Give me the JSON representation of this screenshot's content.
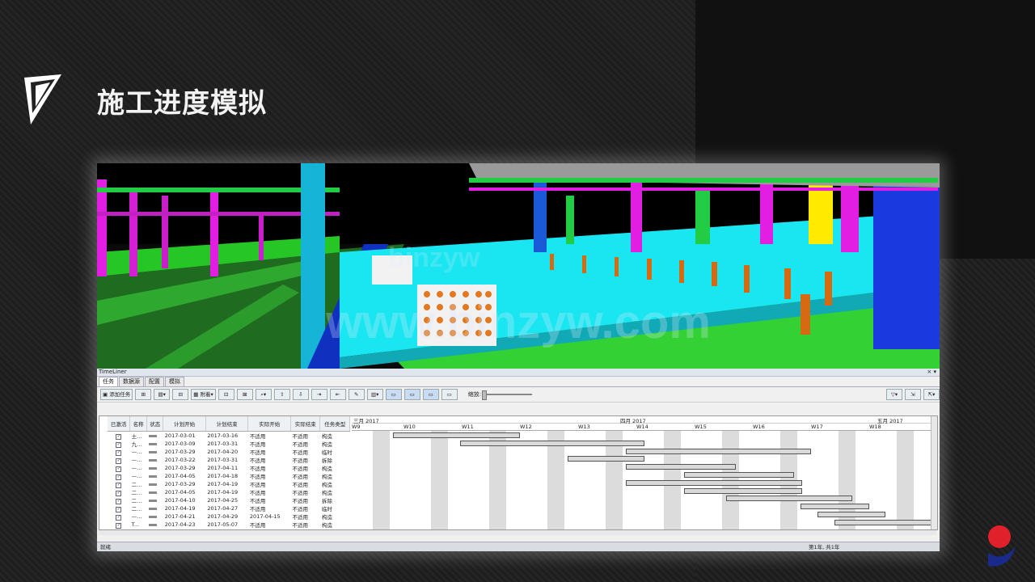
{
  "slide": {
    "title": "施工进度模拟"
  },
  "watermark": {
    "main": "www.binzyw.com",
    "small": "binzyw"
  },
  "timeliner": {
    "window_title": "TimeLiner",
    "tabs": [
      "任务",
      "数据源",
      "配置",
      "模拟"
    ],
    "toolbar": {
      "add_task": "添加任务",
      "attach": "附着",
      "zoom_label": "缩放:"
    },
    "columns": [
      "已激活",
      "名称",
      "状态",
      "计划开始",
      "计划结束",
      "实际开始",
      "实际结束",
      "任务类型"
    ],
    "rows": [
      {
        "name": "土...",
        "plan_start": "2017-03-01",
        "plan_end": "2017-03-16",
        "act_start": "不适用",
        "act_end": "不适用",
        "type": "构造"
      },
      {
        "name": "九...",
        "plan_start": "2017-03-09",
        "plan_end": "2017-03-31",
        "act_start": "不适用",
        "act_end": "不适用",
        "type": "构造"
      },
      {
        "name": "—...",
        "plan_start": "2017-03-29",
        "plan_end": "2017-04-20",
        "act_start": "不适用",
        "act_end": "不适用",
        "type": "临时"
      },
      {
        "name": "—...",
        "plan_start": "2017-03-22",
        "plan_end": "2017-03-31",
        "act_start": "不适用",
        "act_end": "不适用",
        "type": "拆除"
      },
      {
        "name": "—...",
        "plan_start": "2017-03-29",
        "plan_end": "2017-04-11",
        "act_start": "不适用",
        "act_end": "不适用",
        "type": "构造"
      },
      {
        "name": "—...",
        "plan_start": "2017-04-05",
        "plan_end": "2017-04-18",
        "act_start": "不适用",
        "act_end": "不适用",
        "type": "构造"
      },
      {
        "name": "二...",
        "plan_start": "2017-03-29",
        "plan_end": "2017-04-19",
        "act_start": "不适用",
        "act_end": "不适用",
        "type": "构造"
      },
      {
        "name": "二...",
        "plan_start": "2017-04-05",
        "plan_end": "2017-04-19",
        "act_start": "不适用",
        "act_end": "不适用",
        "type": "构造"
      },
      {
        "name": "二...",
        "plan_start": "2017-04-10",
        "plan_end": "2017-04-25",
        "act_start": "不适用",
        "act_end": "不适用",
        "type": "拆除"
      },
      {
        "name": "二...",
        "plan_start": "2017-04-19",
        "plan_end": "2017-04-27",
        "act_start": "不适用",
        "act_end": "不适用",
        "type": "临时"
      },
      {
        "name": "—...",
        "plan_start": "2017-04-21",
        "plan_end": "2017-04-29",
        "act_start": "2017-04-15",
        "act_end": "不适用",
        "type": "构造"
      },
      {
        "name": "T...",
        "plan_start": "2017-04-23",
        "plan_end": "2017-05-07",
        "act_start": "不适用",
        "act_end": "不适用",
        "type": "构造"
      }
    ],
    "gantt": {
      "months": [
        "三月 2017",
        "四月 2017",
        "五月 2017"
      ],
      "weeks": [
        "W9",
        "W10",
        "W11",
        "W12",
        "W13",
        "W14",
        "W15",
        "W16",
        "W17",
        "W18"
      ]
    },
    "status_text": "就绪",
    "page_text": "第1年, 共1年"
  }
}
